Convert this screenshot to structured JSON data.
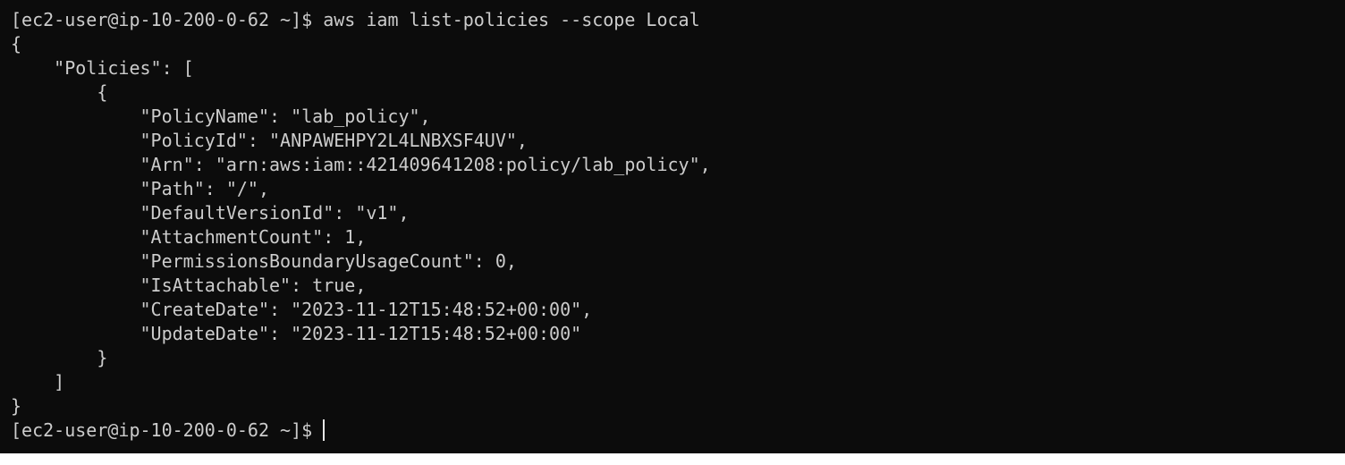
{
  "terminal": {
    "prompt": "[ec2-user@ip-10-200-0-62 ~]$ ",
    "command": "aws iam list-policies --scope Local",
    "output_lines": [
      "{",
      "    \"Policies\": [",
      "        {",
      "            \"PolicyName\": \"lab_policy\",",
      "            \"PolicyId\": \"ANPAWEHPY2L4LNBXSF4UV\",",
      "            \"Arn\": \"arn:aws:iam::421409641208:policy/lab_policy\",",
      "            \"Path\": \"/\",",
      "            \"DefaultVersionId\": \"v1\",",
      "            \"AttachmentCount\": 1,",
      "            \"PermissionsBoundaryUsageCount\": 0,",
      "            \"IsAttachable\": true,",
      "            \"CreateDate\": \"2023-11-12T15:48:52+00:00\",",
      "            \"UpdateDate\": \"2023-11-12T15:48:52+00:00\"",
      "        }",
      "    ]",
      "}"
    ],
    "final_prompt": "[ec2-user@ip-10-200-0-62 ~]$ "
  },
  "colors": {
    "background": "#0c0c0c",
    "text": "#cccccc"
  }
}
